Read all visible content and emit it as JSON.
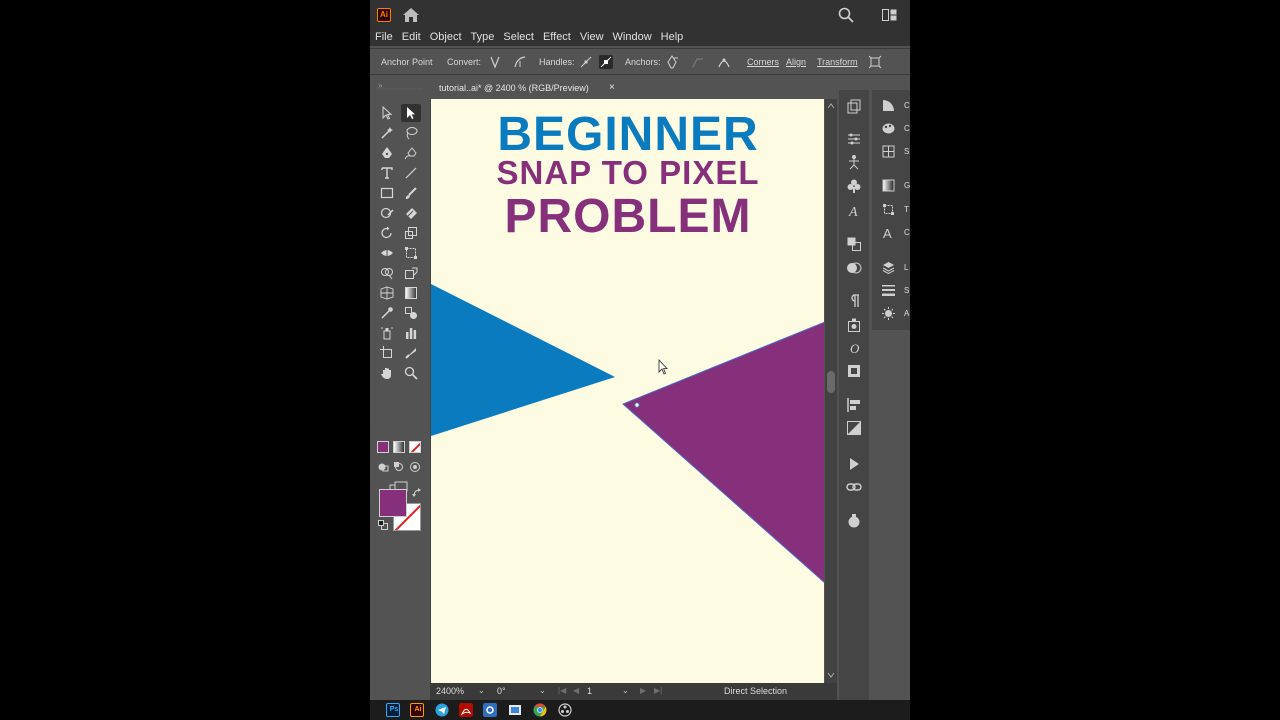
{
  "app": {
    "logo_label": "Ai",
    "menu": [
      "File",
      "Edit",
      "Object",
      "Type",
      "Select",
      "Effect",
      "View",
      "Window",
      "Help"
    ]
  },
  "control_bar": {
    "tool_label": "Anchor Point",
    "convert_label": "Convert:",
    "handles_label": "Handles:",
    "anchors_label": "Anchors:",
    "corners_link": "Corners",
    "align_link": "Align",
    "transform_link": "Transform"
  },
  "document": {
    "tab_title": "tutorial..ai* @ 2400 % (RGB/Preview)",
    "tab_close": "×"
  },
  "artwork": {
    "line1": "BEGINNER",
    "line2": "SNAP TO PIXEL",
    "line3": "PROBLEM",
    "blue": "#0a7bbf",
    "purple": "#862f7a",
    "canvas_color": "#fdfbe2"
  },
  "status_bar": {
    "zoom": "2400%",
    "rotation": "0°",
    "artboard": "1",
    "current_tool": "Direct Selection"
  },
  "right_panel_labels": [
    "C",
    "C",
    "S",
    "G",
    "T",
    "C",
    "L",
    "S",
    "A"
  ],
  "taskbar": {
    "photoshop": "Ps",
    "illustrator": "Ai"
  },
  "colors": {
    "fill": "#862f7a",
    "stroke": "#ffffff",
    "ui_dark": "#323232",
    "ui_mid": "#535353"
  }
}
